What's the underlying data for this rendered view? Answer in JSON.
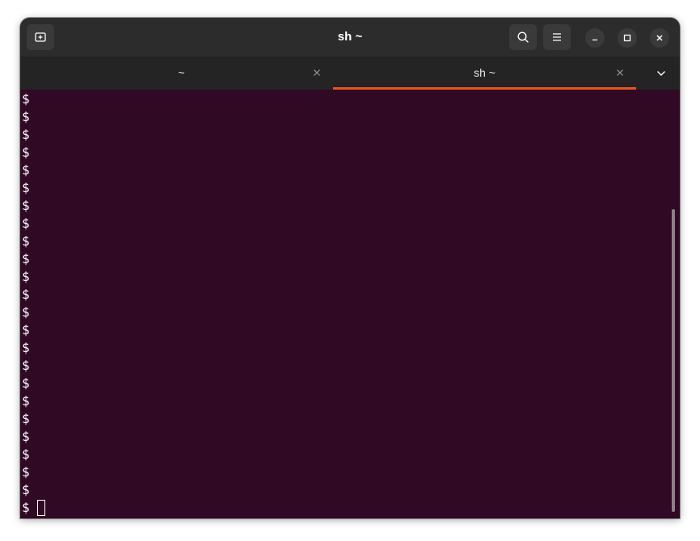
{
  "window": {
    "title": "sh ~"
  },
  "header": {
    "new_tab_icon": "new-tab-icon",
    "search_icon": "search-icon",
    "menu_icon": "hamburger-menu-icon",
    "minimize_icon": "minimize-icon",
    "maximize_icon": "maximize-icon",
    "close_icon": "close-icon"
  },
  "tabs": [
    {
      "label": "~",
      "active": false
    },
    {
      "label": "sh ~",
      "active": true
    }
  ],
  "terminal": {
    "prompt": "$",
    "lines": [
      "$",
      "$",
      "$",
      "$",
      "$",
      "$",
      "$",
      "$",
      "$",
      "$",
      "$",
      "$",
      "$",
      "$",
      "$",
      "$",
      "$",
      "$",
      "$",
      "$",
      "$",
      "$",
      "$"
    ]
  },
  "colors": {
    "accent": "#e95420",
    "terminal_bg": "#300a24",
    "header_bg": "#2c2c2c",
    "tabbar_bg": "#242424"
  }
}
